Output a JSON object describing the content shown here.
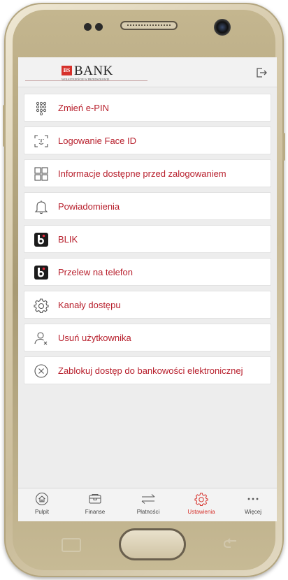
{
  "header": {
    "logo_badge": "BS",
    "logo_name": "BANK",
    "logo_sub": "WOLSZTEJEŃCIE W PRZEDSZKOWIE",
    "logout_icon": "logout-icon"
  },
  "menu": {
    "items": [
      {
        "label": "Zmień e-PIN",
        "icon": "keypad-icon"
      },
      {
        "label": "Logowanie Face ID",
        "icon": "face-id-icon"
      },
      {
        "label": "Informacje dostępne przed zalogowaniem",
        "icon": "grid-icon"
      },
      {
        "label": "Powiadomienia",
        "icon": "bell-icon"
      },
      {
        "label": "BLIK",
        "icon": "blik-icon"
      },
      {
        "label": "Przelew na telefon",
        "icon": "blik-phone-icon"
      },
      {
        "label": "Kanały dostępu",
        "icon": "gear-icon"
      },
      {
        "label": "Usuń użytkownika",
        "icon": "user-remove-icon"
      },
      {
        "label": "Zablokuj dostęp do bankowości elektronicznej",
        "icon": "close-circle-icon"
      }
    ]
  },
  "tabbar": {
    "tabs": [
      {
        "label": "Pulpit",
        "icon": "home-icon"
      },
      {
        "label": "Finanse",
        "icon": "wallet-icon"
      },
      {
        "label": "Płatności",
        "icon": "transfer-icon"
      },
      {
        "label": "Ustawienia",
        "icon": "gear-icon",
        "active": true
      },
      {
        "label": "Więcej",
        "icon": "more-icon"
      }
    ]
  },
  "colors": {
    "accent": "#d6312b",
    "menu_text": "#b8202d"
  }
}
